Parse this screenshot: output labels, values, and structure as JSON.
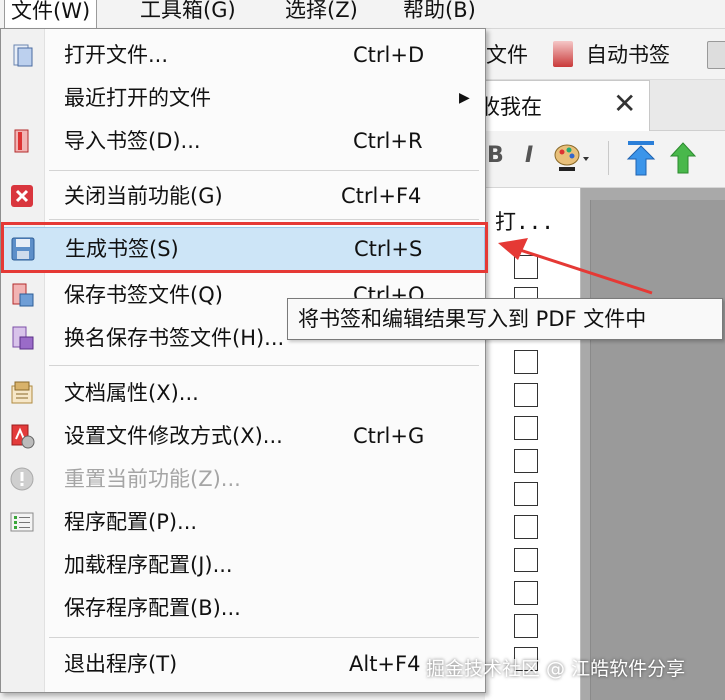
{
  "menubar": {
    "items": [
      "文件(W)",
      "工具箱(G)",
      "选择(Z)",
      "帮助(B)"
    ]
  },
  "toolbar": {
    "file_text": "文件",
    "auto_bookmark": "自动书签"
  },
  "tab": {
    "label": "收我在",
    "close": "✕"
  },
  "format": {
    "bold": "B",
    "italic": "I"
  },
  "list": {
    "column_header": "打..."
  },
  "menu": {
    "items": [
      {
        "label": "打开文件...",
        "shortcut": "Ctrl+D",
        "icon": "open-file-icon"
      },
      {
        "label": "最近打开的文件",
        "shortcut": "",
        "icon": "",
        "submenu": true
      },
      {
        "label": "导入书签(D)...",
        "shortcut": "Ctrl+R",
        "icon": "import-bookmark-icon"
      },
      {
        "label": "关闭当前功能(G)",
        "shortcut": "Ctrl+F4",
        "icon": "close-function-icon"
      },
      {
        "label": "生成书签(S)",
        "shortcut": "Ctrl+S",
        "icon": "save-disk-icon"
      },
      {
        "label": "保存书签文件(Q)",
        "shortcut": "Ctrl+Q",
        "icon": "save-bookmark-file-icon"
      },
      {
        "label": "换名保存书签文件(H)...",
        "shortcut": "",
        "icon": "save-as-icon"
      },
      {
        "label": "文档属性(X)...",
        "shortcut": "",
        "icon": "document-properties-icon"
      },
      {
        "label": "设置文件修改方式(X)...",
        "shortcut": "Ctrl+G",
        "icon": "pdf-settings-icon"
      },
      {
        "label": "重置当前功能(Z)...",
        "shortcut": "",
        "icon": "reset-icon",
        "disabled": true
      },
      {
        "label": "程序配置(P)...",
        "shortcut": "",
        "icon": "config-list-icon"
      },
      {
        "label": "加载程序配置(J)...",
        "shortcut": "",
        "icon": ""
      },
      {
        "label": "保存程序配置(B)...",
        "shortcut": "",
        "icon": ""
      },
      {
        "label": "退出程序(T)",
        "shortcut": "Alt+F4",
        "icon": ""
      }
    ]
  },
  "tooltip": {
    "text": "将书签和编辑结果写入到 PDF 文件中"
  },
  "watermark": {
    "text": "掘金技术社区 @ 江皓软件分享"
  },
  "colors": {
    "highlight": "#cde5f7",
    "annotation_red": "#e53935"
  }
}
